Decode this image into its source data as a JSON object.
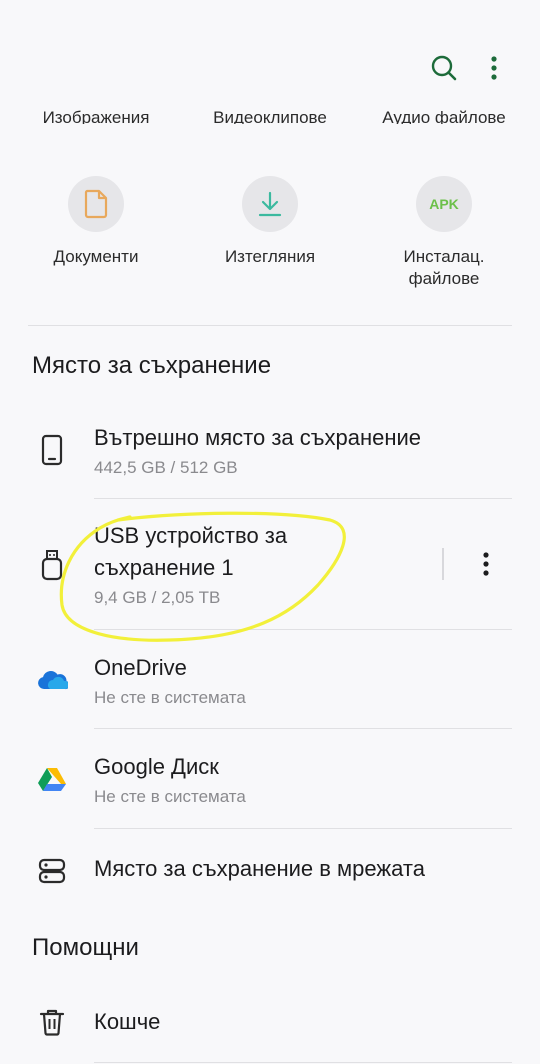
{
  "categories_cut": [
    {
      "label": "Изображения"
    },
    {
      "label": "Видеоклипове"
    },
    {
      "label": "Аудио файлове"
    }
  ],
  "categories": [
    {
      "label": "Документи",
      "icon": "document-icon"
    },
    {
      "label": "Изтегляния",
      "icon": "download-icon"
    },
    {
      "label": "Инсталац.\nфайлове",
      "icon": "apk-icon",
      "icon_text": "APK"
    }
  ],
  "storage": {
    "title": "Място за съхранение",
    "items": [
      {
        "title": "Вътрешно място за съхранение",
        "subtitle": "442,5 GB / 512 GB"
      },
      {
        "title": "USB устройство за\nсъхранение 1",
        "subtitle": "9,4 GB / 2,05 TB"
      },
      {
        "title": "OneDrive",
        "subtitle": "Не сте в системата"
      },
      {
        "title": "Google Диск",
        "subtitle": "Не сте в системата"
      },
      {
        "title": "Място за съхранение в мрежата"
      }
    ]
  },
  "helpers": {
    "title": "Помощни",
    "items": [
      {
        "title": "Кошче"
      }
    ]
  },
  "colors": {
    "accent": "#1d6b3a",
    "highlight": "#f2f03a",
    "download": "#3bb99f",
    "document": "#e8a85c"
  }
}
